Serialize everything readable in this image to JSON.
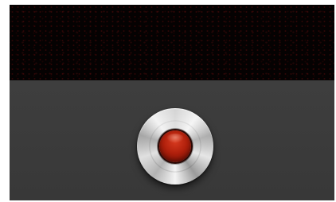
{
  "camera": {
    "record_button": {
      "icon": "record-icon",
      "state": "idle",
      "accent_color": "#b0200c"
    },
    "colors": {
      "viewfinder": "#050202",
      "panel": "#3a3a3a"
    }
  }
}
